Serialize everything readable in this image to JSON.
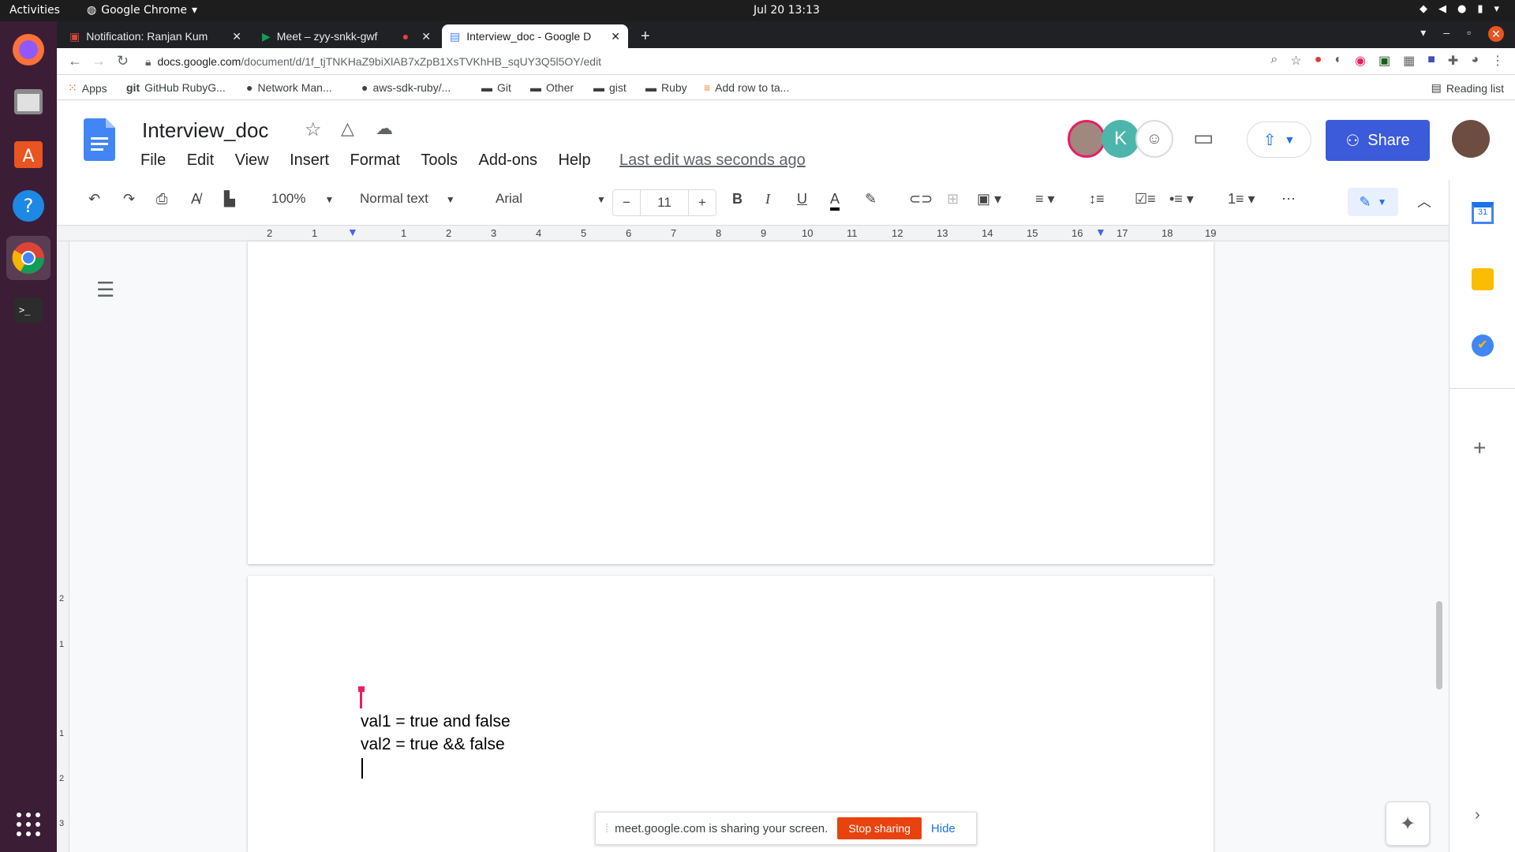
{
  "system": {
    "activities": "Activities",
    "app": "Google Chrome",
    "clock": "Jul 20  13:13"
  },
  "browser": {
    "tabs": [
      {
        "label": "Notification: Ranjan Kum"
      },
      {
        "label": "Meet – zyy-snkk-gwf"
      },
      {
        "label": "Interview_doc - Google D"
      }
    ],
    "url_host": "docs.google.com",
    "url_path": "/document/d/1f_tjTNKHaZ9biXlAB7xZpB1XsTVKhHB_sqUY3Q5l5OY/edit",
    "bookmarks": [
      "Apps",
      "GitHub RubyG...",
      "Network Man...",
      "aws-sdk-ruby/...",
      "Git",
      "Other",
      "gist",
      "Ruby",
      "Add row to ta..."
    ],
    "reading_list": "Reading list"
  },
  "docs": {
    "title": "Interview_doc",
    "menu": [
      "File",
      "Edit",
      "View",
      "Insert",
      "Format",
      "Tools",
      "Add-ons",
      "Help"
    ],
    "last_edit": "Last edit was seconds ago",
    "share": "Share",
    "collaborator_initial": "K",
    "zoom": "100%",
    "style": "Normal text",
    "font": "Arial",
    "font_size": "11",
    "ruler_labels": [
      "2",
      "1",
      "1",
      "2",
      "3",
      "4",
      "5",
      "6",
      "7",
      "8",
      "9",
      "10",
      "11",
      "12",
      "13",
      "14",
      "15",
      "16",
      "17",
      "18",
      "19"
    ],
    "vruler_labels": [
      "2",
      "1",
      "1",
      "2",
      "3"
    ],
    "content": [
      "val1 = true and false",
      "val2 = true && false"
    ]
  },
  "banner": {
    "text": "meet.google.com is sharing your screen.",
    "stop": "Stop sharing",
    "hide": "Hide"
  },
  "colors": {
    "accent": "#3b5bdb",
    "stop": "#e8430e"
  }
}
